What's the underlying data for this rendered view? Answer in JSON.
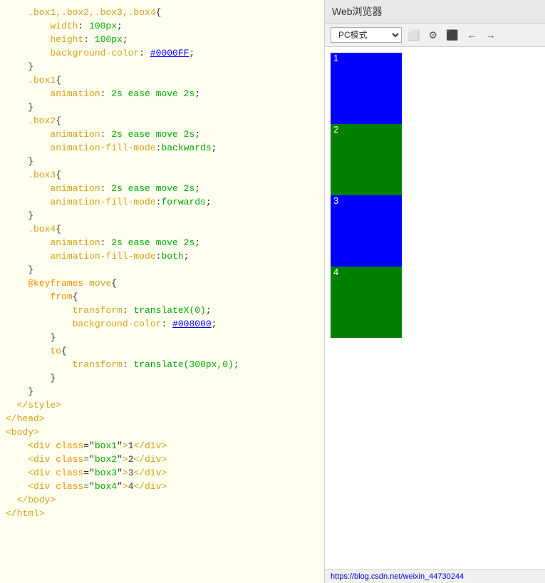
{
  "browser": {
    "title": "Web浏览器",
    "mode_label": "PC模式",
    "status_url": "https://blog.csdn.net/weixin_44730244",
    "boxes": [
      {
        "label": "1",
        "color": "#0000ff"
      },
      {
        "label": "2",
        "color": "#008000"
      },
      {
        "label": "3",
        "color": "#0000ff"
      },
      {
        "label": "4",
        "color": "#008000"
      }
    ]
  },
  "code_lines": [
    {
      "num": "",
      "text": "    .box1,.box2,.box3,.box4{"
    },
    {
      "num": "",
      "text": "        width: 100px;"
    },
    {
      "num": "",
      "text": "        height: 100px;"
    },
    {
      "num": "",
      "text": "        background-color: #0000FF;"
    },
    {
      "num": "",
      "text": "    }"
    },
    {
      "num": "",
      "text": "    .box1{"
    },
    {
      "num": "",
      "text": "        animation: 2s ease move 2s;"
    },
    {
      "num": "",
      "text": "    }"
    },
    {
      "num": "",
      "text": "    .box2{"
    },
    {
      "num": "",
      "text": "        animation: 2s ease move 2s;"
    },
    {
      "num": "",
      "text": "        animation-fill-mode:backwards;"
    },
    {
      "num": "",
      "text": "    }"
    },
    {
      "num": "",
      "text": "    .box3{"
    },
    {
      "num": "",
      "text": "        animation: 2s ease move 2s;"
    },
    {
      "num": "",
      "text": "        animation-fill-mode:forwards;"
    },
    {
      "num": "",
      "text": "    }"
    },
    {
      "num": "",
      "text": "    .box4{"
    },
    {
      "num": "",
      "text": "        animation: 2s ease move 2s;"
    },
    {
      "num": "",
      "text": "        animation-fill-mode:both;"
    },
    {
      "num": "",
      "text": "    }"
    },
    {
      "num": "",
      "text": "    @keyframes move{"
    },
    {
      "num": "",
      "text": "        from{"
    },
    {
      "num": "",
      "text": "            transform: translateX(0);"
    },
    {
      "num": "",
      "text": "            background-color: #008000;"
    },
    {
      "num": "",
      "text": "        }"
    },
    {
      "num": "",
      "text": "        to{"
    },
    {
      "num": "",
      "text": "            transform: translate(300px,0);"
    },
    {
      "num": "",
      "text": "        }"
    },
    {
      "num": "",
      "text": "    }"
    },
    {
      "num": "",
      "text": "  </style>"
    },
    {
      "num": "",
      "text": "</head>"
    },
    {
      "num": "",
      "text": "<body>"
    },
    {
      "num": "",
      "text": "    <div class=\"box1\">1</div>"
    },
    {
      "num": "",
      "text": "    <div class=\"box2\">2</div>"
    },
    {
      "num": "",
      "text": "    <div class=\"box3\">3</div>"
    },
    {
      "num": "",
      "text": "    <div class=\"box4\">4</div>"
    },
    {
      "num": "",
      "text": "  </body>"
    },
    {
      "num": "",
      "text": "</html>"
    }
  ]
}
